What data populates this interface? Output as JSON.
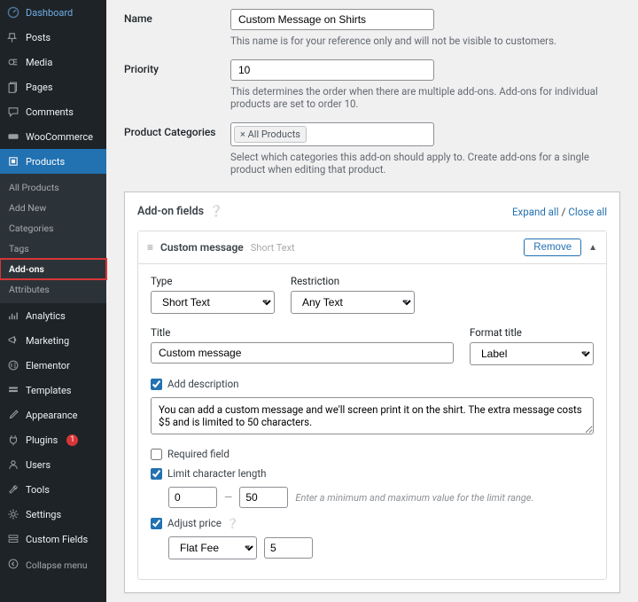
{
  "sidebar": {
    "items": [
      {
        "icon": "dashboard",
        "label": "Dashboard"
      },
      {
        "icon": "pin",
        "label": "Posts"
      },
      {
        "icon": "media",
        "label": "Media"
      },
      {
        "icon": "page",
        "label": "Pages"
      },
      {
        "icon": "comment",
        "label": "Comments"
      },
      {
        "icon": "woo",
        "label": "WooCommerce"
      },
      {
        "icon": "product",
        "label": "Products",
        "active": true
      },
      {
        "icon": "chart",
        "label": "Analytics"
      },
      {
        "icon": "megaphone",
        "label": "Marketing"
      },
      {
        "icon": "elem",
        "label": "Elementor"
      },
      {
        "icon": "templates",
        "label": "Templates"
      },
      {
        "icon": "brush",
        "label": "Appearance"
      },
      {
        "icon": "plug",
        "label": "Plugins",
        "badge": "1"
      },
      {
        "icon": "users",
        "label": "Users"
      },
      {
        "icon": "wrench",
        "label": "Tools"
      },
      {
        "icon": "gear",
        "label": "Settings"
      },
      {
        "icon": "cf",
        "label": "Custom Fields"
      }
    ],
    "submenu": [
      "All Products",
      "Add New",
      "Categories",
      "Tags",
      "Add-ons",
      "Attributes"
    ],
    "submenu_hl": 4,
    "collapse": "Collapse menu"
  },
  "form": {
    "name_label": "Name",
    "name_value": "Custom Message on Shirts",
    "name_help": "This name is for your reference only and will not be visible to customers.",
    "priority_label": "Priority",
    "priority_value": "10",
    "priority_help": "This determines the order when there are multiple add-ons. Add-ons for individual products are set to order 10.",
    "cat_label": "Product Categories",
    "cat_tag": "× All Products",
    "cat_help": "Select which categories this add-on should apply to. Create add-ons for a single product when editing that product."
  },
  "card": {
    "title": "Add-on fields",
    "expand": "Expand all",
    "sep": " / ",
    "close": "Close all"
  },
  "field": {
    "head_title": "Custom message",
    "head_sub": "Short Text",
    "remove": "Remove",
    "type_label": "Type",
    "type_value": "Short Text",
    "restriction_label": "Restriction",
    "restriction_value": "Any Text",
    "title_label": "Title",
    "title_value": "Custom message",
    "format_label": "Format title",
    "format_value": "Label",
    "add_desc": "Add description",
    "desc_value": "You can add a custom message and we'll screen print it on the shirt. The extra message costs $5 and is limited to 50 characters.",
    "required": "Required field",
    "limit": "Limit character length",
    "limit_min": "0",
    "limit_max": "50",
    "limit_hint": "Enter a minimum and maximum value for the limit range.",
    "adjust": "Adjust price",
    "price_type": "Flat Fee",
    "price_val": "5"
  }
}
